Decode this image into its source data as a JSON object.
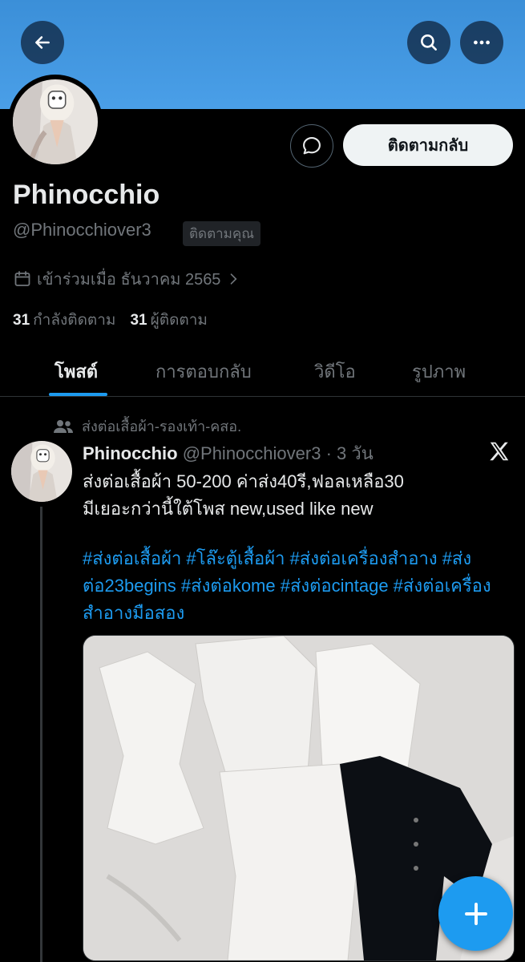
{
  "header": {
    "back_icon": "arrow-left-icon",
    "search_icon": "search-icon",
    "more_icon": "more-horizontal-icon"
  },
  "colors": {
    "banner": "#4a9fe8",
    "accent": "#1d9bf0",
    "background": "#000000"
  },
  "profile": {
    "name": "Phinocchio",
    "handle": "@Phinocchiover3",
    "follows_you_badge": "ติดตามคุณ",
    "follow_back_label": "ติดตามกลับ",
    "joined": "เข้าร่วมเมื่อ ธันวาคม 2565",
    "following_count": "31",
    "following_label": "กำลังติดตาม",
    "followers_count": "31",
    "followers_label": "ผู้ติดตาม"
  },
  "tabs": [
    {
      "label": "โพสต์",
      "active": true
    },
    {
      "label": "การตอบกลับ",
      "active": false
    },
    {
      "label": "วิดีโอ",
      "active": false
    },
    {
      "label": "รูปภาพ",
      "active": false
    }
  ],
  "post": {
    "context": "ส่งต่อเสื้อผ้า-รองเท้า-คสอ.",
    "author_name": "Phinocchio",
    "author_handle": "@Phinocchiover3",
    "separator": "·",
    "time": "3 วัน",
    "text_line1": "ส่งต่อเสื้อผ้า 50-200 ค่าส่ง40รี,ฟอลเหลือ30",
    "text_line2": "มีเยอะกว่านี้ใต้โพส new,used like new",
    "hashtags": "#ส่งต่อเสื้อผ้า #โล๊ะตู้เสื้อผ้า #ส่งต่อเครื่องสำอาง #ส่งต่อ23begins #ส่งต่อkome #ส่งต่อcintage #ส่งต่อเครื่องสำอางมือสอง"
  }
}
